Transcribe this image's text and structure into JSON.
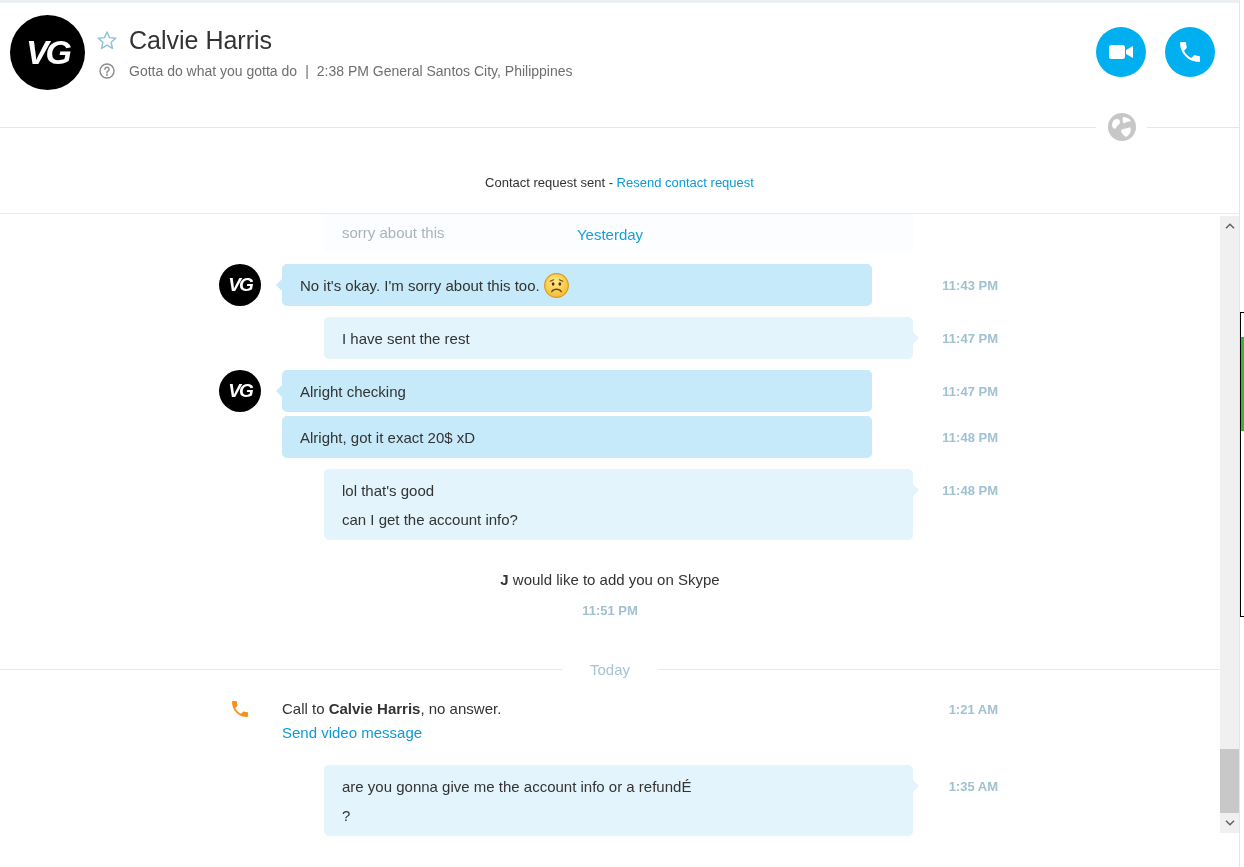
{
  "header": {
    "avatar_text": "VG",
    "favorite": false,
    "name": "Calvie Harris",
    "status_message": "Gotta do what you gotta do",
    "separator": "|",
    "local_time": "2:38 PM General Santos City, Philippines"
  },
  "contact_request": {
    "text": "Contact request sent -",
    "link": "Resend contact request"
  },
  "chat": {
    "sticky_date": "Yesterday",
    "items": [
      {
        "kind": "outgoing",
        "faded": true,
        "lines": [
          "sorry about this"
        ]
      },
      {
        "kind": "incoming",
        "avatar_text": "VG",
        "lines": [
          "No it's okay. I'm sorry about this too."
        ],
        "emoji": true,
        "time": "11:43 PM"
      },
      {
        "kind": "outgoing",
        "faded": false,
        "lines": [
          "I have sent the rest"
        ],
        "time": "11:47 PM"
      },
      {
        "kind": "incoming",
        "avatar_text": "VG",
        "lines": [
          "Alright checking"
        ],
        "time": "11:47 PM"
      },
      {
        "kind": "incoming",
        "lines": [
          "Alright, got it exact 20$ xD"
        ],
        "time": "11:48 PM"
      },
      {
        "kind": "outgoing",
        "faded": false,
        "lines": [
          "lol that's good",
          "can I get the account info?"
        ],
        "time": "11:48 PM"
      },
      {
        "kind": "contact_request",
        "text": "**J** would like to add you on Skype",
        "time": "11:51 PM"
      },
      {
        "kind": "date_divider",
        "label": "Today"
      },
      {
        "kind": "call",
        "text": "Call to **Calvie Harris**, no answer.",
        "link": "Send video message",
        "time": "1:21 AM"
      },
      {
        "kind": "outgoing",
        "faded": false,
        "lines": [
          "are you gonna give me the account info or a refundÉ",
          "?"
        ],
        "time": "1:35 AM"
      }
    ]
  }
}
